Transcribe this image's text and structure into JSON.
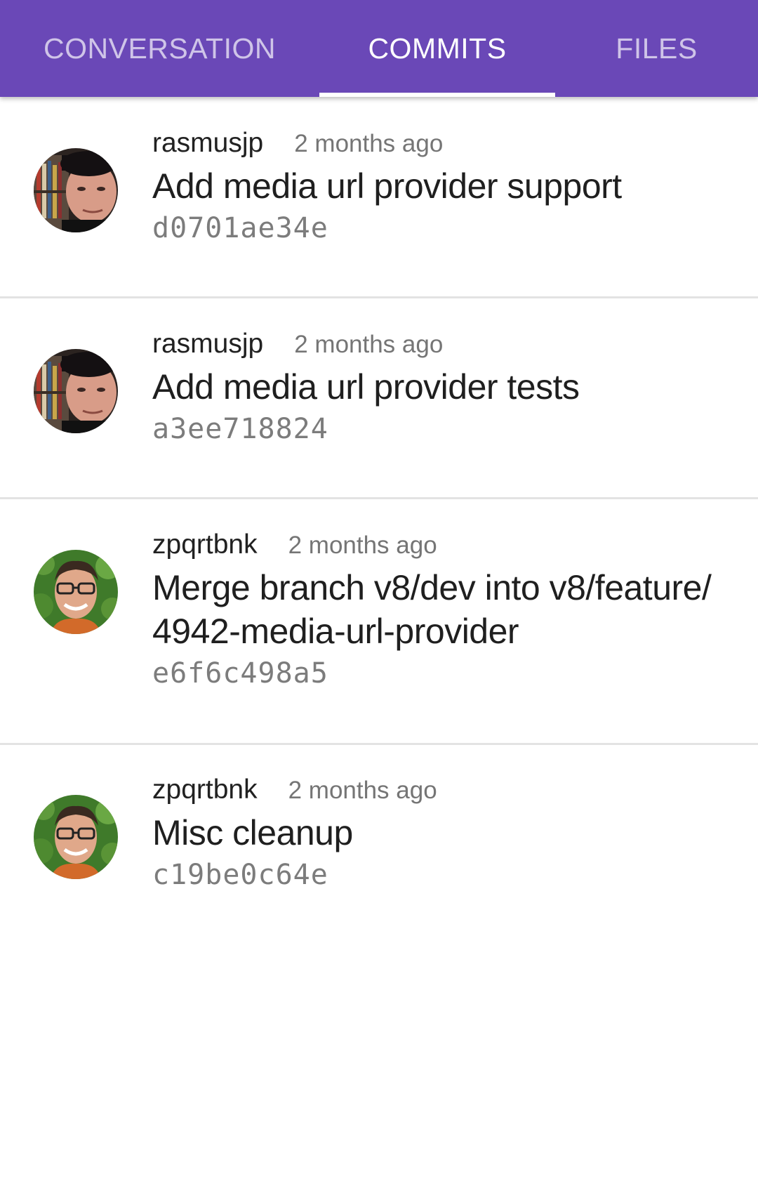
{
  "tabs": [
    {
      "label": "CONVERSATION",
      "active": false
    },
    {
      "label": "COMMITS",
      "active": true
    },
    {
      "label": "FILES",
      "active": false
    }
  ],
  "colors": {
    "tab_bar": "#6a48b7",
    "tab_active_text": "#ffffff",
    "tab_inactive_text": "#c9bbe8",
    "divider": "#e3e3e3"
  },
  "commits": [
    {
      "author": "rasmusjp",
      "time": "2 months ago",
      "message": "Add media url provider support",
      "sha": "d0701ae34e",
      "avatar": "rasmusjp-avatar"
    },
    {
      "author": "rasmusjp",
      "time": "2 months ago",
      "message": "Add media url provider tests",
      "sha": "a3ee718824",
      "avatar": "rasmusjp-avatar"
    },
    {
      "author": "zpqrtbnk",
      "time": "2 months ago",
      "message_line1": "Merge branch v8/dev into v8/feature/",
      "message_line2": "4942-media-url-provider",
      "sha": "e6f6c498a5",
      "avatar": "zpqrtbnk-avatar"
    },
    {
      "author": "zpqrtbnk",
      "time": "2 months ago",
      "message": "Misc cleanup",
      "sha": "c19be0c64e",
      "avatar": "zpqrtbnk-avatar"
    }
  ]
}
